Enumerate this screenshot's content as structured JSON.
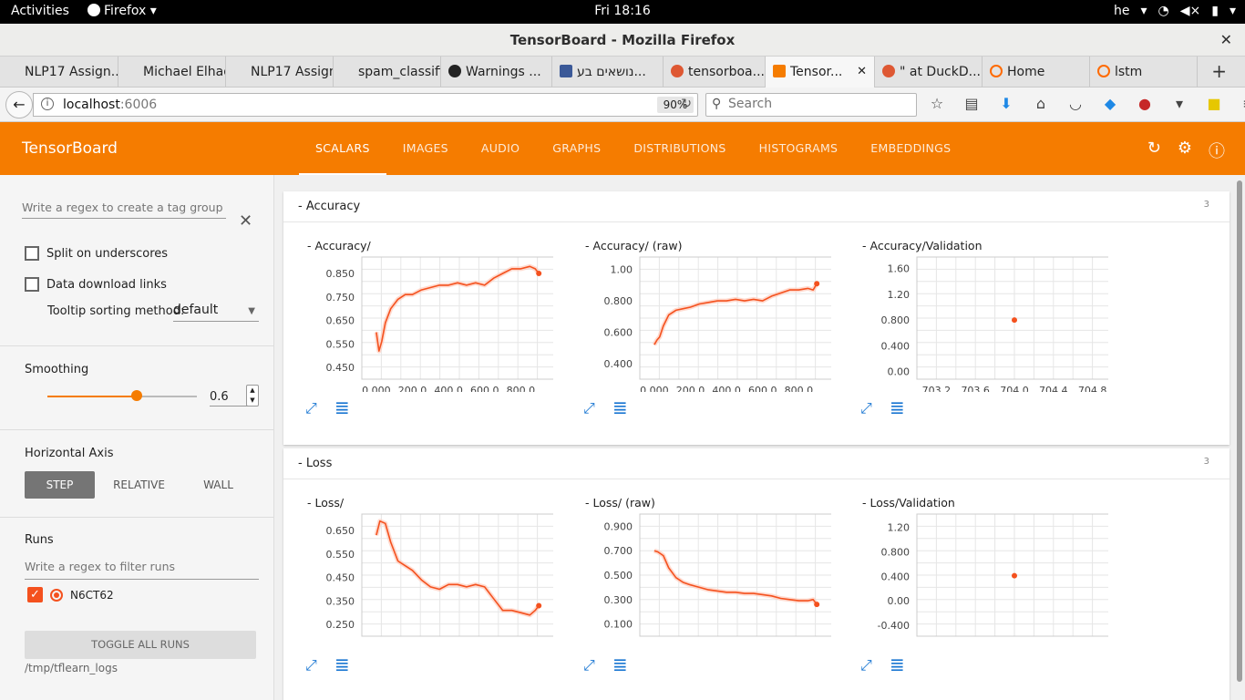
{
  "system": {
    "activities": "Activities",
    "app_name": "Firefox",
    "clock": "Fri 18:16",
    "lang": "he"
  },
  "window": {
    "title": "TensorBoard - Mozilla Firefox"
  },
  "tabs": [
    {
      "label": "NLP17 Assign...",
      "color": "#cccccc"
    },
    {
      "label": "Michael Elhad...",
      "color": "#cccccc"
    },
    {
      "label": "NLP17 Assign...",
      "color": "#cccccc"
    },
    {
      "label": "spam_classifier",
      "color": "#cccccc"
    },
    {
      "label": "Warnings ...",
      "color": "#222222"
    },
    {
      "label": "נושאים בע...",
      "color": "#3b5998"
    },
    {
      "label": "tensorboa...",
      "color": "#de5833"
    },
    {
      "label": "Tensor...",
      "color": "#f57c00"
    },
    {
      "label": "\" at DuckD...",
      "color": "#de5833"
    },
    {
      "label": "Home",
      "color": "#ff6a00"
    },
    {
      "label": "lstm",
      "color": "#ff6a00"
    }
  ],
  "nav": {
    "url_host": "localhost",
    "url_port": ":6006",
    "zoom": "90%",
    "search_placeholder": "Search"
  },
  "tb": {
    "brand": "TensorBoard",
    "tabs": [
      "SCALARS",
      "IMAGES",
      "AUDIO",
      "GRAPHS",
      "DISTRIBUTIONS",
      "HISTOGRAMS",
      "EMBEDDINGS"
    ],
    "accent": "#f57c00"
  },
  "sidebar": {
    "tag_regex_placeholder": "Write a regex to create a tag group",
    "split_label": "Split on underscores",
    "download_label": "Data download links",
    "tooltip_label": "Tooltip sorting method:",
    "tooltip_value": "default",
    "smoothing_label": "Smoothing",
    "smoothing_value": "0.6",
    "smoothing_fraction": 0.6,
    "horizontal_axis_label": "Horizontal Axis",
    "axis_options": [
      "STEP",
      "RELATIVE",
      "WALL"
    ],
    "runs_label": "Runs",
    "runs_placeholder": "Write a regex to filter runs",
    "run_name": "N6CT62",
    "toggle_label": "TOGGLE ALL RUNS",
    "logdir": "/tmp/tflearn_logs"
  },
  "groups": [
    {
      "title": "- Accuracy",
      "count": "3"
    },
    {
      "title": "- Loss",
      "count": "3"
    }
  ],
  "chart_data": [
    {
      "type": "line",
      "title": "- Accuracy/",
      "x_ticks": [
        "0.000",
        "200.0",
        "400.0",
        "600.0",
        "800.0"
      ],
      "y_ticks": [
        "0.450",
        "0.550",
        "0.650",
        "0.750",
        "0.850"
      ],
      "xlim": [
        -80,
        1000
      ],
      "ylim": [
        0.4,
        0.92
      ],
      "series": [
        {
          "x": [
            0,
            15,
            30,
            50,
            80,
            120,
            160,
            200,
            250,
            300,
            350,
            400,
            450,
            500,
            550,
            600,
            650,
            700,
            750,
            800,
            850,
            880,
            900
          ],
          "y": [
            0.6,
            0.52,
            0.56,
            0.64,
            0.7,
            0.74,
            0.76,
            0.76,
            0.78,
            0.79,
            0.8,
            0.8,
            0.81,
            0.8,
            0.81,
            0.8,
            0.83,
            0.85,
            0.87,
            0.87,
            0.88,
            0.87,
            0.85
          ]
        }
      ]
    },
    {
      "type": "line",
      "title": "- Accuracy/ (raw)",
      "x_ticks": [
        "0.000",
        "200.0",
        "400.0",
        "600.0",
        "800.0"
      ],
      "y_ticks": [
        "0.400",
        "0.600",
        "0.800",
        "1.00"
      ],
      "xlim": [
        -80,
        1000
      ],
      "ylim": [
        0.3,
        1.08
      ],
      "series": [
        {
          "x": [
            0,
            15,
            30,
            50,
            80,
            120,
            160,
            200,
            250,
            300,
            350,
            400,
            450,
            500,
            550,
            600,
            650,
            700,
            750,
            800,
            850,
            880,
            900
          ],
          "y": [
            0.52,
            0.55,
            0.57,
            0.64,
            0.71,
            0.74,
            0.75,
            0.76,
            0.78,
            0.79,
            0.8,
            0.8,
            0.81,
            0.8,
            0.81,
            0.8,
            0.83,
            0.85,
            0.87,
            0.87,
            0.88,
            0.87,
            0.91
          ]
        }
      ]
    },
    {
      "type": "scatter",
      "title": "- Accuracy/Validation",
      "x_ticks": [
        "703.2",
        "703.6",
        "704.0",
        "704.4",
        "704.8"
      ],
      "y_ticks": [
        "0.00",
        "0.400",
        "0.800",
        "1.20",
        "1.60"
      ],
      "xlim": [
        703.0,
        705.0
      ],
      "ylim": [
        -0.12,
        1.78
      ],
      "series": [
        {
          "x": [
            704.0
          ],
          "y": [
            0.8
          ]
        }
      ]
    },
    {
      "type": "line",
      "title": "- Loss/",
      "x_ticks": [],
      "y_ticks": [
        "0.250",
        "0.350",
        "0.450",
        "0.550",
        "0.650"
      ],
      "xlim": [
        -80,
        1000
      ],
      "ylim": [
        0.2,
        0.72
      ],
      "series": [
        {
          "x": [
            0,
            20,
            50,
            80,
            120,
            160,
            200,
            250,
            300,
            350,
            400,
            450,
            500,
            550,
            600,
            650,
            700,
            750,
            800,
            850,
            880,
            900
          ],
          "y": [
            0.63,
            0.69,
            0.68,
            0.6,
            0.52,
            0.5,
            0.48,
            0.44,
            0.41,
            0.4,
            0.42,
            0.42,
            0.41,
            0.42,
            0.41,
            0.36,
            0.31,
            0.31,
            0.3,
            0.29,
            0.31,
            0.33
          ]
        }
      ]
    },
    {
      "type": "line",
      "title": "- Loss/ (raw)",
      "x_ticks": [],
      "y_ticks": [
        "0.100",
        "0.300",
        "0.500",
        "0.700",
        "0.900"
      ],
      "xlim": [
        -80,
        1000
      ],
      "ylim": [
        0.0,
        1.0
      ],
      "series": [
        {
          "x": [
            0,
            20,
            50,
            80,
            120,
            160,
            200,
            250,
            300,
            350,
            400,
            450,
            500,
            550,
            600,
            650,
            700,
            750,
            800,
            850,
            880,
            900
          ],
          "y": [
            0.7,
            0.69,
            0.66,
            0.56,
            0.48,
            0.44,
            0.42,
            0.4,
            0.38,
            0.37,
            0.36,
            0.36,
            0.35,
            0.35,
            0.34,
            0.33,
            0.31,
            0.3,
            0.29,
            0.29,
            0.3,
            0.26
          ]
        }
      ]
    },
    {
      "type": "scatter",
      "title": "- Loss/Validation",
      "x_ticks": [],
      "y_ticks": [
        "-0.400",
        "0.00",
        "0.400",
        "0.800",
        "1.20"
      ],
      "xlim": [
        703.0,
        705.0
      ],
      "ylim": [
        -0.58,
        1.42
      ],
      "series": [
        {
          "x": [
            704.0
          ],
          "y": [
            0.41
          ]
        }
      ]
    }
  ]
}
